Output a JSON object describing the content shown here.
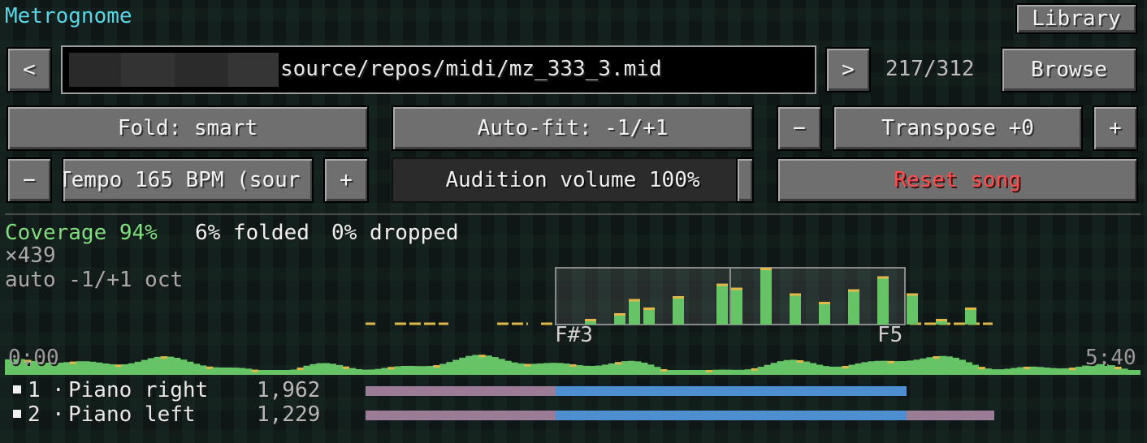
{
  "app": {
    "title": "Metrognome"
  },
  "header": {
    "library_label": "Library"
  },
  "file": {
    "prev_label": "<",
    "next_label": ">",
    "path": "source/repos/midi/mz_333_3.mid",
    "counter": "217/312",
    "browse_label": "Browse"
  },
  "controls": {
    "fold_label": "Fold: smart",
    "autofit_label": "Auto-fit: -1/+1",
    "transpose_minus": "−",
    "transpose_label": "Transpose +0",
    "transpose_plus": "+",
    "tempo_minus": "−",
    "tempo_label": "Tempo 165 BPM (sour",
    "tempo_plus": "+",
    "volume_label": "Audition volume 100%",
    "volume_level": 1.0,
    "reset_label": "Reset song"
  },
  "stats": {
    "coverage": "Coverage 94%",
    "folded": "6% folded",
    "dropped": "0% dropped",
    "multiplier": "×439",
    "autofit": "auto -1/+1 oct",
    "range_low": "F#3",
    "range_high": "F5",
    "time_start": "0:00",
    "time_end": "5:40"
  },
  "histogram": {
    "bars": [
      0.0,
      0.1,
      0.0,
      0.2,
      0.45,
      0.3,
      0.0,
      0.5,
      0.0,
      0.0,
      0.72,
      0.65,
      0.0,
      1.0,
      0.0,
      0.55,
      0.0,
      0.4,
      0.0,
      0.62,
      0.0,
      0.85,
      0.0,
      0.55,
      0.0,
      0.1,
      0.0,
      0.3,
      0.0,
      0.0,
      0.4,
      0.0,
      0.3,
      0.0,
      0.25,
      0.15,
      0.0,
      0.0
    ]
  },
  "tracks": [
    {
      "index": "1",
      "name": "Piano right",
      "count": "1,962",
      "range": [
        0.0,
        1.0
      ],
      "inwin": [
        0.0,
        1.0
      ]
    },
    {
      "index": "2",
      "name": "Piano left",
      "count": "1,229",
      "range": [
        0.0,
        1.0
      ],
      "inwin": [
        0.0,
        1.0
      ]
    }
  ],
  "colors": {
    "title": "#55d7e6",
    "coverage": "#7fe07f",
    "reset": "#ff4d4d",
    "green": "#66c466",
    "gold": "#e0b84a",
    "track_purple": "#9a7c97",
    "track_blue": "#4d8fd1"
  }
}
